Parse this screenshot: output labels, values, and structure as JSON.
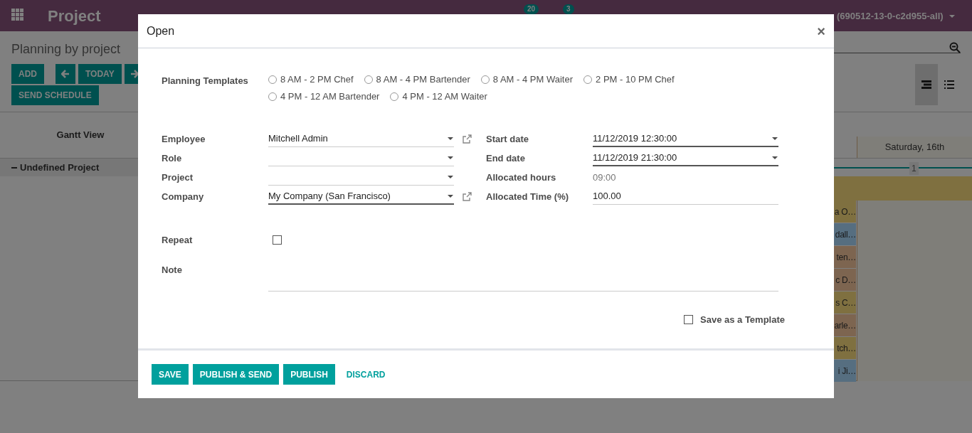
{
  "navbar": {
    "app_name": "Project",
    "activity_count": "20",
    "message_count": "3",
    "user": "(690512-13-0-c2d955-all)"
  },
  "control_panel": {
    "title": "Planning by project",
    "buttons": [
      {
        "label": "ADD",
        "kind": "text"
      },
      {
        "kind": "prev"
      },
      {
        "label": "TODAY",
        "kind": "text"
      },
      {
        "kind": "next"
      },
      {
        "label": "SEND SCHEDULE",
        "kind": "text"
      }
    ],
    "views": [
      {
        "kind": "gantt",
        "selected": true
      },
      {
        "kind": "list",
        "selected": false
      }
    ]
  },
  "gantt": {
    "title": "Gantt View",
    "day_header": "Saturday, 16th",
    "group": {
      "label": "Undefined Project",
      "expanded": true
    },
    "count_label": "1",
    "pills": [
      {
        "text": "a O…",
        "color": "#7f7040"
      },
      {
        "text": "dall…",
        "color": "#566e80"
      },
      {
        "text": "ten…",
        "color": "#7d6550"
      },
      {
        "text": "c D…",
        "color": "#7d6550"
      },
      {
        "text": "s C…",
        "color": "#7f7040"
      },
      {
        "text": "arle…",
        "color": "#7d6550"
      },
      {
        "text": "tch…",
        "color": "#7f7040"
      },
      {
        "text": "i Ji…",
        "color": "#566e80"
      }
    ]
  },
  "dialog": {
    "title": "Open",
    "close": "×",
    "templates": {
      "label": "Planning Templates",
      "options": [
        {
          "label": "8 AM - 2 PM Chef",
          "selected": false
        },
        {
          "label": "8 AM - 4 PM Bartender",
          "selected": false
        },
        {
          "label": "8 AM - 4 PM Waiter",
          "selected": false
        },
        {
          "label": "2 PM - 10 PM Chef",
          "selected": false
        },
        {
          "label": "4 PM - 12 AM Bartender",
          "selected": false
        },
        {
          "label": "4 PM - 12 AM Waiter",
          "selected": false
        }
      ]
    },
    "left_fields": [
      {
        "label": "Employee",
        "value": "Mitchell Admin",
        "kind": "select",
        "required": false,
        "external_link": true
      },
      {
        "label": "Role",
        "kind": "select",
        "required": false,
        "external_link": false
      },
      {
        "label": "Project",
        "kind": "select",
        "required": false,
        "external_link": false
      },
      {
        "label": "Company",
        "value": "My Company (San Francisco)",
        "kind": "select",
        "required": true,
        "external_link": true
      }
    ],
    "right_fields": [
      {
        "label": "Start date",
        "value": "11/12/2019 12:30:00",
        "kind": "select",
        "required": true
      },
      {
        "label": "End date",
        "value": "11/12/2019 21:30:00",
        "kind": "select",
        "required": true
      },
      {
        "label": "Allocated hours",
        "value": "09:00",
        "kind": "readonly"
      },
      {
        "label": "Allocated Time (%)",
        "value": "100.00",
        "kind": "text",
        "required": false
      }
    ],
    "repeat": {
      "label": "Repeat",
      "checked": false
    },
    "note": {
      "label": "Note"
    },
    "save_template": {
      "label": "Save as a Template",
      "checked": false
    },
    "buttons": [
      {
        "label": "SAVE",
        "kind": "primary"
      },
      {
        "label": "PUBLISH & SEND",
        "kind": "primary"
      },
      {
        "label": "PUBLISH",
        "kind": "primary"
      },
      {
        "label": "DISCARD",
        "kind": "link"
      }
    ]
  }
}
